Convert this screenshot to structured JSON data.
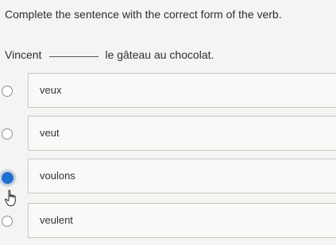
{
  "question": {
    "prompt": "Complete the sentence with the correct form of the verb.",
    "sentence_before": "Vincent",
    "sentence_after": "le gâteau au chocolat."
  },
  "options": [
    {
      "label": "veux",
      "selected": false
    },
    {
      "label": "veut",
      "selected": false
    },
    {
      "label": "voulons",
      "selected": true
    },
    {
      "label": "veulent",
      "selected": false
    }
  ],
  "colors": {
    "selected_radio": "#1f6fd1",
    "card_border": "#c7c7c4",
    "background": "#f4f4f2"
  },
  "icons": {
    "cursor": "hand-pointer-icon"
  }
}
